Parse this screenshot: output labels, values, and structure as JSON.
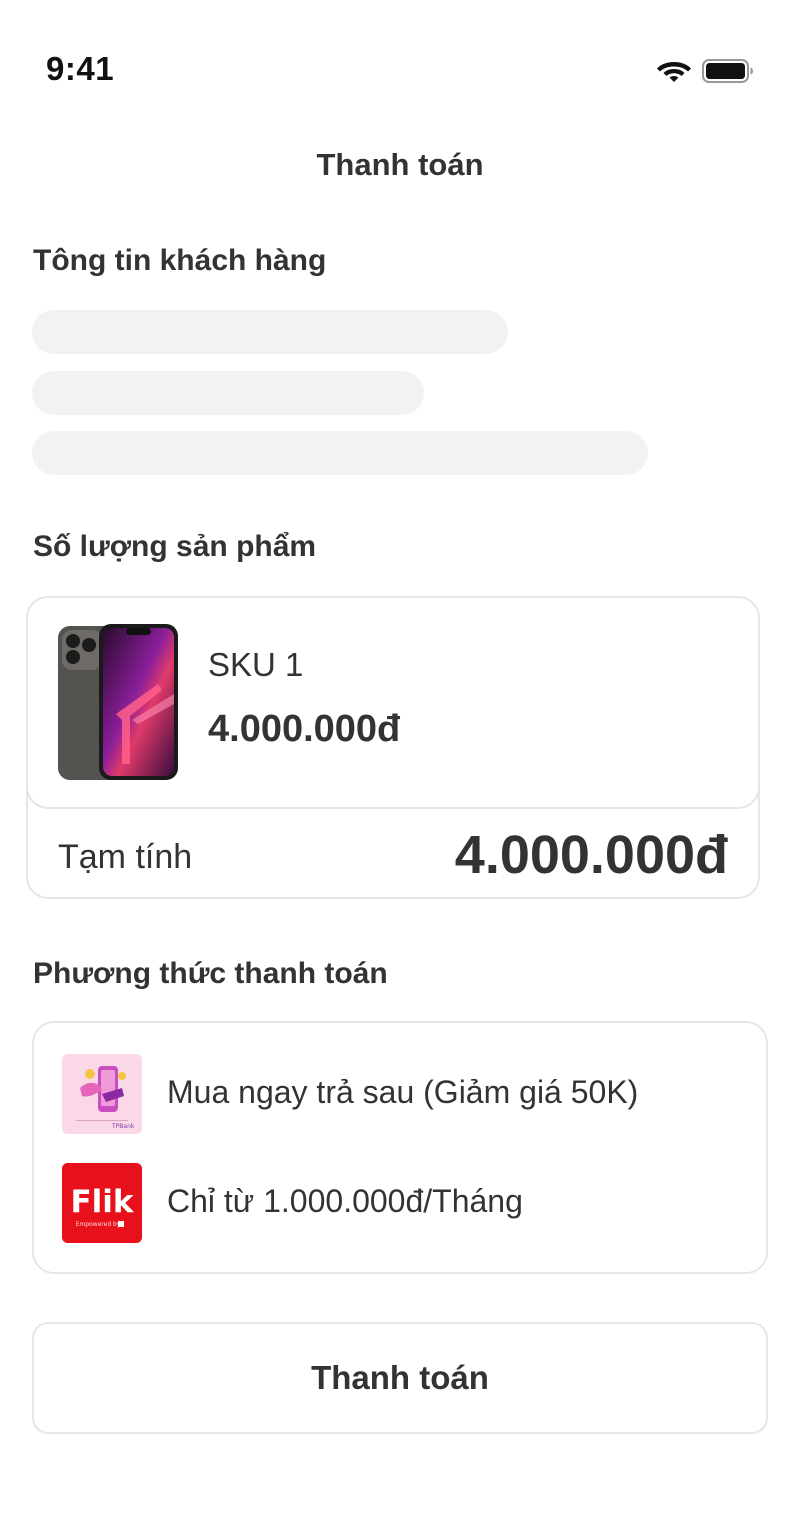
{
  "status_bar": {
    "time": "9:41",
    "wifi_icon": "wifi-icon",
    "battery_icon": "battery-icon"
  },
  "header": {
    "title": "Thanh toán"
  },
  "customer_section": {
    "title": "Tông tin khách hàng"
  },
  "product_section": {
    "title": "Số lượng sản phẩm",
    "item": {
      "sku": "SKU 1",
      "price": "4.000.000đ",
      "image_icon": "phone-image"
    },
    "subtotal_label": "Tạm tính",
    "subtotal_value": "4.000.000đ"
  },
  "payment_section": {
    "title": "Phương thức thanh toán",
    "options": [
      {
        "label": "Mua ngay trả sau (Giảm giá 50K)",
        "logo_icon": "tpbank-paylater-logo",
        "logo_caption": "TPBank"
      },
      {
        "label": "Chỉ từ 1.000.000đ/Tháng",
        "logo_icon": "flik-logo",
        "logo_text": "Flik",
        "logo_caption": "Empowered by"
      }
    ]
  },
  "submit": {
    "label": "Thanh toán"
  },
  "colors": {
    "text": "#333333",
    "border": "#e6e6e6",
    "skeleton": "#f2f2f2",
    "flik_red": "#e8101a",
    "paylater_pink": "#f7c8dd"
  }
}
